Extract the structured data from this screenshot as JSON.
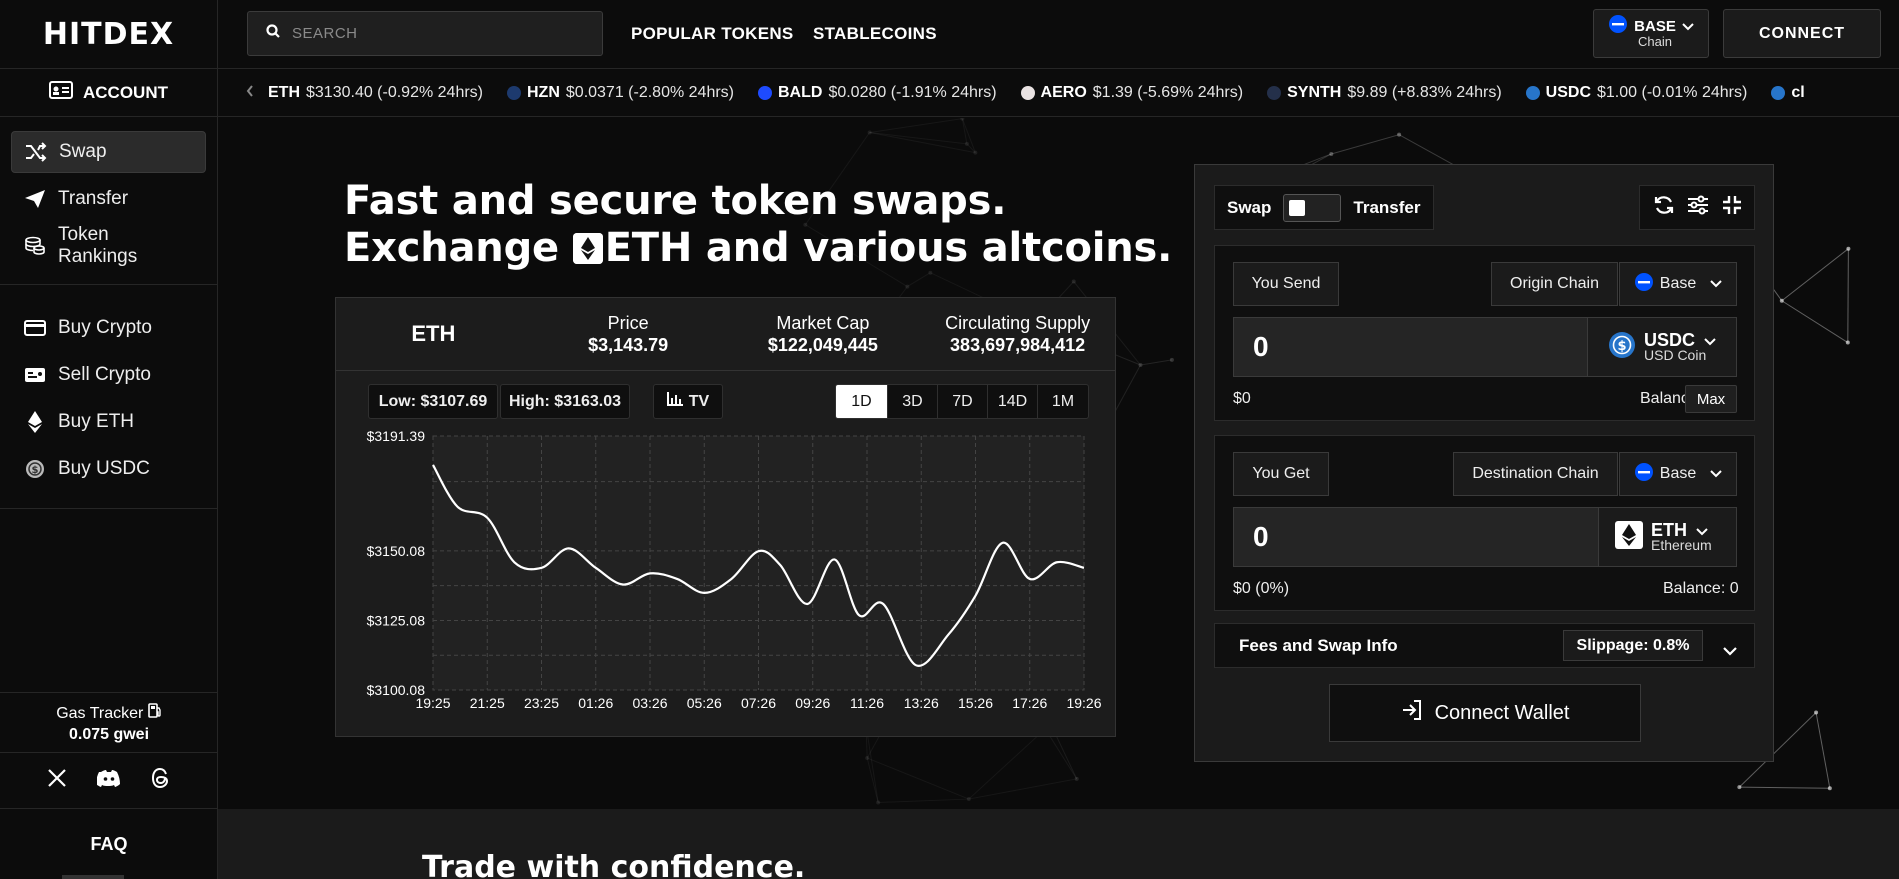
{
  "brand": {
    "logo": "HITDEX"
  },
  "sidebar": {
    "account": "ACCOUNT",
    "primary": [
      {
        "label": "Swap",
        "icon": "shuffle-icon",
        "active": true
      },
      {
        "label": "Transfer",
        "icon": "send-icon"
      },
      {
        "label": "Token Rankings",
        "icon": "coin-stack-icon"
      }
    ],
    "secondary": [
      {
        "label": "Buy Crypto",
        "icon": "credit-card-icon"
      },
      {
        "label": "Sell Crypto",
        "icon": "id-card-icon"
      },
      {
        "label": "Buy ETH",
        "icon": "eth-icon"
      },
      {
        "label": "Buy USDC",
        "icon": "usdc-icon"
      }
    ],
    "gas_label": "Gas Tracker",
    "gas_value": "0.075 gwei",
    "socials": [
      "x-icon",
      "discord-icon",
      "threads-icon"
    ],
    "faq": "FAQ"
  },
  "header": {
    "search_placeholder": "SEARCH",
    "links": [
      "POPULAR TOKENS",
      "STABLECOINS"
    ],
    "chain_name": "BASE",
    "chain_sub": "Chain",
    "connect": "CONNECT"
  },
  "ticker": [
    {
      "sym": "ETH",
      "text": "$3130.40 (-0.92% 24hrs)",
      "color": "#888888"
    },
    {
      "sym": "HZN",
      "text": "$0.0371 (-2.80% 24hrs)",
      "color": "#1d3a6e"
    },
    {
      "sym": "BALD",
      "text": "$0.0280 (-1.91% 24hrs)",
      "color": "#1e4bff"
    },
    {
      "sym": "AERO",
      "text": "$1.39 (-5.69% 24hrs)",
      "color": "#e9e2e2"
    },
    {
      "sym": "SYNTH",
      "text": "$9.89 (+8.83% 24hrs)",
      "color": "#24304a"
    },
    {
      "sym": "USDC",
      "text": "$1.00 (-0.01% 24hrs)",
      "color": "#2775ca"
    },
    {
      "sym": "cl",
      "text": "",
      "color": "#2775ca"
    }
  ],
  "hero": {
    "line1": "Fast and secure token swaps.",
    "line2_a": "Exchange",
    "line2_b": "ETH and various altcoins."
  },
  "stats": {
    "symbol": "ETH",
    "price_label": "Price",
    "price": "$3,143.79",
    "mcap_label": "Market Cap",
    "mcap": "$122,049,445",
    "supply_label": "Circulating Supply",
    "supply": "383,697,984,412",
    "low": "Low: $3107.69",
    "high": "High: $3163.03",
    "tv": "TV",
    "ranges": [
      "1D",
      "3D",
      "7D",
      "14D",
      "1M"
    ],
    "active_range": "1D"
  },
  "chart_data": {
    "type": "line",
    "y_tick_labels": [
      "$3191.39",
      "$3150.08",
      "$3125.08",
      "$3100.08"
    ],
    "y_ticks": [
      3191.39,
      3150.08,
      3125.08,
      3100.08
    ],
    "ylim": [
      3100.08,
      3191.39
    ],
    "x_tick_labels": [
      "19:25",
      "21:25",
      "23:25",
      "01:26",
      "03:26",
      "05:26",
      "07:26",
      "09:26",
      "11:26",
      "13:26",
      "15:26",
      "17:26",
      "19:26"
    ],
    "grid": true,
    "series": [
      {
        "values": [
          [
            0,
            3181
          ],
          [
            0.45,
            3166
          ],
          [
            1,
            3162
          ],
          [
            1.5,
            3146
          ],
          [
            2,
            3144
          ],
          [
            2.5,
            3151
          ],
          [
            3,
            3144
          ],
          [
            3.5,
            3138
          ],
          [
            4,
            3142
          ],
          [
            4.5,
            3140
          ],
          [
            5,
            3135
          ],
          [
            5.5,
            3140
          ],
          [
            6,
            3150
          ],
          [
            6.4,
            3145
          ],
          [
            6.9,
            3131
          ],
          [
            7.4,
            3147
          ],
          [
            7.85,
            3127
          ],
          [
            8.3,
            3131
          ],
          [
            8.9,
            3109
          ],
          [
            9.5,
            3120
          ],
          [
            10,
            3134
          ],
          [
            10.5,
            3153
          ],
          [
            11,
            3140
          ],
          [
            11.5,
            3146
          ],
          [
            12,
            3144
          ]
        ]
      }
    ]
  },
  "swap": {
    "swap_label": "Swap",
    "transfer_label": "Transfer",
    "you_send": "You Send",
    "origin_chain": "Origin Chain",
    "origin_value": "Base",
    "send_amount": "0",
    "send_token": "USDC",
    "send_token_name": "USD Coin",
    "send_usd": "$0",
    "send_balance": "Balance: 0",
    "max": "Max",
    "you_get": "You Get",
    "dest_chain": "Destination Chain",
    "dest_value": "Base",
    "get_amount": "0",
    "get_token": "ETH",
    "get_token_name": "Ethereum",
    "get_usd": "$0 (0%)",
    "get_balance": "Balance: 0",
    "fees": "Fees and Swap Info",
    "slippage": "Slippage: 0.8%",
    "connect_wallet": "Connect Wallet"
  },
  "footer": {
    "title": "Trade with confidence."
  }
}
